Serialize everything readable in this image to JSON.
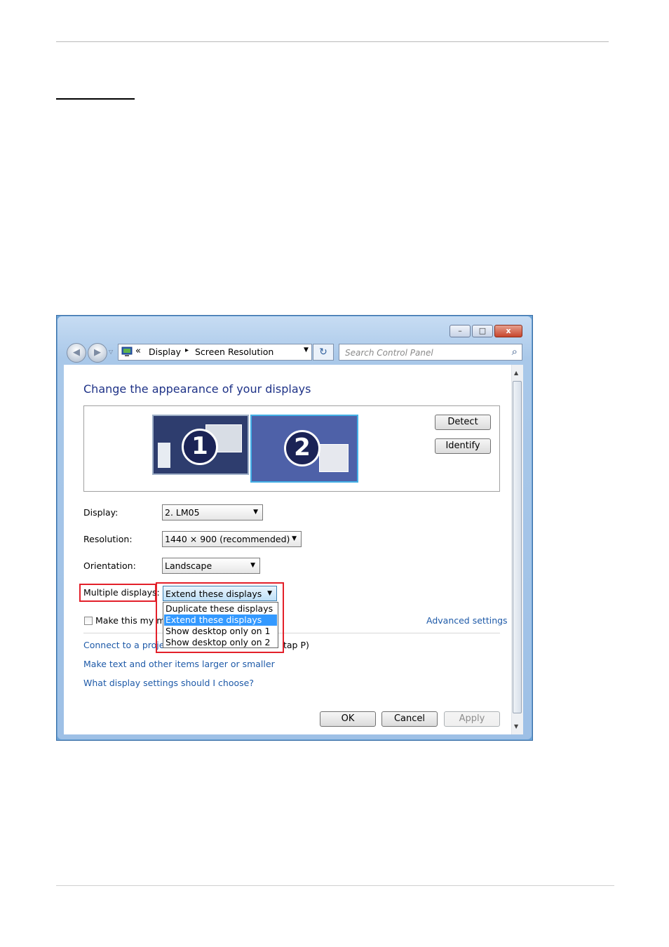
{
  "window": {
    "minimize_glyph": "–",
    "maximize_glyph": "□",
    "close_glyph": "x"
  },
  "nav": {
    "back_glyph": "◀",
    "forward_glyph": "▶",
    "breadcrumb_chevron": "«",
    "breadcrumb": [
      "Display",
      "Screen Resolution"
    ],
    "breadcrumb_separator": "▸",
    "refresh_glyph": "↻",
    "search_placeholder": "Search Control Panel",
    "search_glyph": "⌕"
  },
  "main": {
    "title": "Change the appearance of your displays",
    "monitors": [
      {
        "number": "1",
        "selected": false
      },
      {
        "number": "2",
        "selected": true
      }
    ],
    "detect_label": "Detect",
    "identify_label": "Identify",
    "display_label": "Display:",
    "display_value": "2. LM05",
    "resolution_label": "Resolution:",
    "resolution_value": "1440 × 900 (recommended)",
    "orientation_label": "Orientation:",
    "orientation_value": "Landscape",
    "multiple_displays_label": "Multiple displays:",
    "multiple_displays_value": "Extend these displays",
    "multiple_displays_options": [
      "Duplicate these displays",
      "Extend these displays",
      "Show desktop only on 1",
      "Show desktop only on 2"
    ],
    "multiple_displays_selected_index": 1,
    "main_display_checkbox_label": "Make this my ma",
    "main_display_checked": false,
    "advanced_settings_link": "Advanced settings",
    "projector_link_start": "Connect to a projec",
    "projector_link_end": "tap P)",
    "text_size_link": "Make text and other items larger or smaller",
    "help_link": "What display settings should I choose?",
    "ok_label": "OK",
    "cancel_label": "Cancel",
    "apply_label": "Apply"
  },
  "colors": {
    "highlight_box": "#e3202a",
    "selection": "#3399ff",
    "link": "#1e5aa8",
    "title": "#1e3287"
  }
}
